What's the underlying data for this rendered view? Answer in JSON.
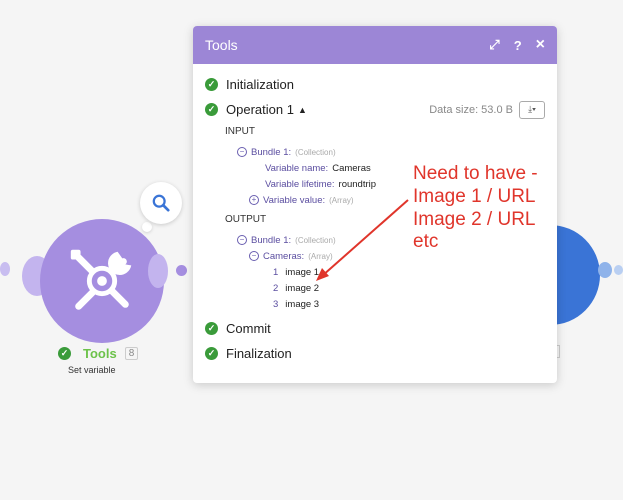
{
  "left_module": {
    "name": "Tools",
    "id": "8",
    "subtitle": "Set variable",
    "icon": "tools-icon"
  },
  "right_module": {
    "id": "2"
  },
  "panel": {
    "title": "Tools",
    "header_icons": [
      "expand-icon",
      "help-icon",
      "close-icon"
    ],
    "header_expand": "⤢",
    "header_help": "?",
    "header_close": "×",
    "rows": {
      "initialization": "Initialization",
      "operation": "Operation 1",
      "commit": "Commit",
      "finalization": "Finalization"
    },
    "data_size": "Data size: 53.0 B",
    "input": {
      "title": "INPUT",
      "bundle_label": "Bundle 1:",
      "bundle_type": "(Collection)",
      "var_name_key": "Variable name:",
      "var_name_val": "Cameras",
      "var_lifetime_key": "Variable lifetime:",
      "var_lifetime_val": "roundtrip",
      "var_value_key": "Variable value:",
      "var_value_type": "(Array)"
    },
    "output": {
      "title": "OUTPUT",
      "bundle_label": "Bundle 1:",
      "bundle_type": "(Collection)",
      "cameras_key": "Cameras:",
      "cameras_type": "(Array)",
      "items": [
        {
          "index": "1",
          "value": "image 1"
        },
        {
          "index": "2",
          "value": "image 2"
        },
        {
          "index": "3",
          "value": "image 3"
        }
      ]
    }
  },
  "annotation": {
    "line1": "Need to have -",
    "line2": "Image 1 / URL",
    "line3": "Image 2 / URL",
    "line4": "etc",
    "color": "#e0352b"
  }
}
